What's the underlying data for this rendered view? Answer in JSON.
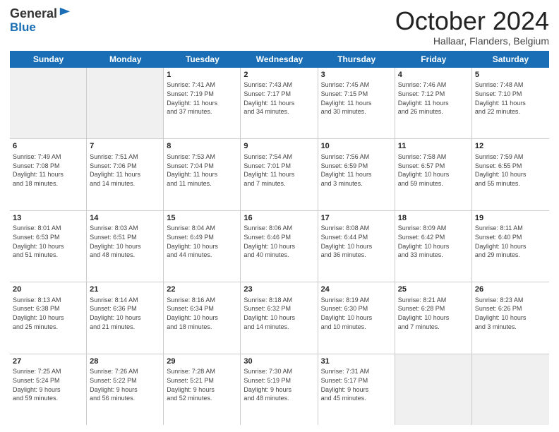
{
  "header": {
    "logo_line1": "General",
    "logo_line2": "Blue",
    "month": "October 2024",
    "location": "Hallaar, Flanders, Belgium"
  },
  "days_of_week": [
    "Sunday",
    "Monday",
    "Tuesday",
    "Wednesday",
    "Thursday",
    "Friday",
    "Saturday"
  ],
  "weeks": [
    [
      {
        "day": "",
        "info": "",
        "shaded": true
      },
      {
        "day": "",
        "info": "",
        "shaded": true
      },
      {
        "day": "1",
        "info": "Sunrise: 7:41 AM\nSunset: 7:19 PM\nDaylight: 11 hours\nand 37 minutes."
      },
      {
        "day": "2",
        "info": "Sunrise: 7:43 AM\nSunset: 7:17 PM\nDaylight: 11 hours\nand 34 minutes."
      },
      {
        "day": "3",
        "info": "Sunrise: 7:45 AM\nSunset: 7:15 PM\nDaylight: 11 hours\nand 30 minutes."
      },
      {
        "day": "4",
        "info": "Sunrise: 7:46 AM\nSunset: 7:12 PM\nDaylight: 11 hours\nand 26 minutes."
      },
      {
        "day": "5",
        "info": "Sunrise: 7:48 AM\nSunset: 7:10 PM\nDaylight: 11 hours\nand 22 minutes."
      }
    ],
    [
      {
        "day": "6",
        "info": "Sunrise: 7:49 AM\nSunset: 7:08 PM\nDaylight: 11 hours\nand 18 minutes."
      },
      {
        "day": "7",
        "info": "Sunrise: 7:51 AM\nSunset: 7:06 PM\nDaylight: 11 hours\nand 14 minutes."
      },
      {
        "day": "8",
        "info": "Sunrise: 7:53 AM\nSunset: 7:04 PM\nDaylight: 11 hours\nand 11 minutes."
      },
      {
        "day": "9",
        "info": "Sunrise: 7:54 AM\nSunset: 7:01 PM\nDaylight: 11 hours\nand 7 minutes."
      },
      {
        "day": "10",
        "info": "Sunrise: 7:56 AM\nSunset: 6:59 PM\nDaylight: 11 hours\nand 3 minutes."
      },
      {
        "day": "11",
        "info": "Sunrise: 7:58 AM\nSunset: 6:57 PM\nDaylight: 10 hours\nand 59 minutes."
      },
      {
        "day": "12",
        "info": "Sunrise: 7:59 AM\nSunset: 6:55 PM\nDaylight: 10 hours\nand 55 minutes."
      }
    ],
    [
      {
        "day": "13",
        "info": "Sunrise: 8:01 AM\nSunset: 6:53 PM\nDaylight: 10 hours\nand 51 minutes."
      },
      {
        "day": "14",
        "info": "Sunrise: 8:03 AM\nSunset: 6:51 PM\nDaylight: 10 hours\nand 48 minutes."
      },
      {
        "day": "15",
        "info": "Sunrise: 8:04 AM\nSunset: 6:49 PM\nDaylight: 10 hours\nand 44 minutes."
      },
      {
        "day": "16",
        "info": "Sunrise: 8:06 AM\nSunset: 6:46 PM\nDaylight: 10 hours\nand 40 minutes."
      },
      {
        "day": "17",
        "info": "Sunrise: 8:08 AM\nSunset: 6:44 PM\nDaylight: 10 hours\nand 36 minutes."
      },
      {
        "day": "18",
        "info": "Sunrise: 8:09 AM\nSunset: 6:42 PM\nDaylight: 10 hours\nand 33 minutes."
      },
      {
        "day": "19",
        "info": "Sunrise: 8:11 AM\nSunset: 6:40 PM\nDaylight: 10 hours\nand 29 minutes."
      }
    ],
    [
      {
        "day": "20",
        "info": "Sunrise: 8:13 AM\nSunset: 6:38 PM\nDaylight: 10 hours\nand 25 minutes."
      },
      {
        "day": "21",
        "info": "Sunrise: 8:14 AM\nSunset: 6:36 PM\nDaylight: 10 hours\nand 21 minutes."
      },
      {
        "day": "22",
        "info": "Sunrise: 8:16 AM\nSunset: 6:34 PM\nDaylight: 10 hours\nand 18 minutes."
      },
      {
        "day": "23",
        "info": "Sunrise: 8:18 AM\nSunset: 6:32 PM\nDaylight: 10 hours\nand 14 minutes."
      },
      {
        "day": "24",
        "info": "Sunrise: 8:19 AM\nSunset: 6:30 PM\nDaylight: 10 hours\nand 10 minutes."
      },
      {
        "day": "25",
        "info": "Sunrise: 8:21 AM\nSunset: 6:28 PM\nDaylight: 10 hours\nand 7 minutes."
      },
      {
        "day": "26",
        "info": "Sunrise: 8:23 AM\nSunset: 6:26 PM\nDaylight: 10 hours\nand 3 minutes."
      }
    ],
    [
      {
        "day": "27",
        "info": "Sunrise: 7:25 AM\nSunset: 5:24 PM\nDaylight: 9 hours\nand 59 minutes."
      },
      {
        "day": "28",
        "info": "Sunrise: 7:26 AM\nSunset: 5:22 PM\nDaylight: 9 hours\nand 56 minutes."
      },
      {
        "day": "29",
        "info": "Sunrise: 7:28 AM\nSunset: 5:21 PM\nDaylight: 9 hours\nand 52 minutes."
      },
      {
        "day": "30",
        "info": "Sunrise: 7:30 AM\nSunset: 5:19 PM\nDaylight: 9 hours\nand 48 minutes."
      },
      {
        "day": "31",
        "info": "Sunrise: 7:31 AM\nSunset: 5:17 PM\nDaylight: 9 hours\nand 45 minutes."
      },
      {
        "day": "",
        "info": "",
        "shaded": true
      },
      {
        "day": "",
        "info": "",
        "shaded": true
      }
    ]
  ]
}
